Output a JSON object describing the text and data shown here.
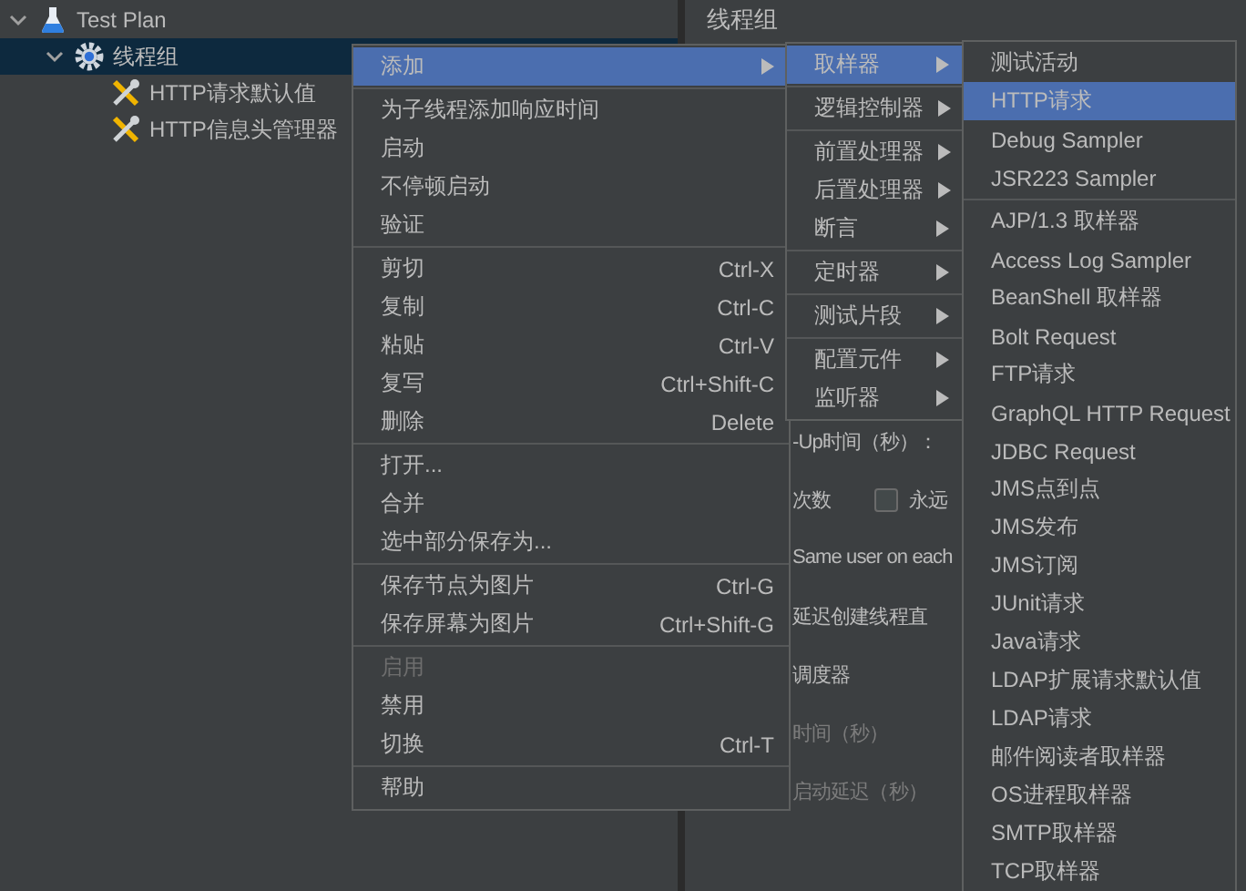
{
  "tree": [
    {
      "label": "Test Plan",
      "kind": "flask",
      "expanded": true,
      "selected": false,
      "children": [
        {
          "label": "线程组",
          "kind": "gear",
          "expanded": true,
          "selected": true,
          "children": [
            {
              "label": "HTTP请求默认值",
              "kind": "tools",
              "selected": false
            },
            {
              "label": "HTTP信息头管理器",
              "kind": "tools",
              "selected": false
            }
          ]
        }
      ]
    }
  ],
  "panel": {
    "title": "线程组",
    "fields": [
      {
        "kind": "label",
        "text": "-Up时间（秒）："
      },
      {
        "kind": "checkbox",
        "text": "次数",
        "option": "永远",
        "checked": false
      },
      {
        "kind": "label",
        "text": "Same user on each"
      },
      {
        "kind": "label",
        "text": "延迟创建线程直"
      },
      {
        "kind": "label",
        "text": "调度器"
      },
      {
        "kind": "disabled",
        "text": "时间（秒）"
      },
      {
        "kind": "disabled",
        "text": "启动延迟（秒）"
      }
    ]
  },
  "context_menu": [
    [
      {
        "label": "添加",
        "submenu": true,
        "selected": true,
        "disabled": false
      }
    ],
    [
      {
        "label": "为子线程添加响应时间",
        "selected": false,
        "disabled": false
      },
      {
        "label": "启动",
        "selected": false,
        "disabled": false
      },
      {
        "label": "不停顿启动",
        "selected": false,
        "disabled": false
      },
      {
        "label": "验证",
        "selected": false,
        "disabled": false
      }
    ],
    [
      {
        "label": "剪切",
        "shortcut": "Ctrl-X",
        "selected": false,
        "disabled": false
      },
      {
        "label": "复制",
        "shortcut": "Ctrl-C",
        "selected": false,
        "disabled": false
      },
      {
        "label": "粘贴",
        "shortcut": "Ctrl-V",
        "selected": false,
        "disabled": false
      },
      {
        "label": "复写",
        "shortcut": "Ctrl+Shift-C",
        "selected": false,
        "disabled": false
      },
      {
        "label": "删除",
        "shortcut": "Delete",
        "selected": false,
        "disabled": false
      }
    ],
    [
      {
        "label": "打开...",
        "selected": false,
        "disabled": false
      },
      {
        "label": "合并",
        "selected": false,
        "disabled": false
      },
      {
        "label": "选中部分保存为...",
        "selected": false,
        "disabled": false
      }
    ],
    [
      {
        "label": "保存节点为图片",
        "shortcut": "Ctrl-G",
        "selected": false,
        "disabled": false
      },
      {
        "label": "保存屏幕为图片",
        "shortcut": "Ctrl+Shift-G",
        "selected": false,
        "disabled": false
      }
    ],
    [
      {
        "label": "启用",
        "selected": false,
        "disabled": true
      },
      {
        "label": "禁用",
        "selected": false,
        "disabled": false
      },
      {
        "label": "切换",
        "shortcut": "Ctrl-T",
        "selected": false,
        "disabled": false
      }
    ],
    [
      {
        "label": "帮助",
        "selected": false,
        "disabled": false
      }
    ]
  ],
  "add_menu": [
    [
      {
        "label": "取样器",
        "submenu": true,
        "selected": true
      }
    ],
    [
      {
        "label": "逻辑控制器",
        "submenu": true,
        "selected": false
      }
    ],
    [
      {
        "label": "前置处理器",
        "submenu": true,
        "selected": false
      },
      {
        "label": "后置处理器",
        "submenu": true,
        "selected": false
      },
      {
        "label": "断言",
        "submenu": true,
        "selected": false
      }
    ],
    [
      {
        "label": "定时器",
        "submenu": true,
        "selected": false
      }
    ],
    [
      {
        "label": "测试片段",
        "submenu": true,
        "selected": false
      }
    ],
    [
      {
        "label": "配置元件",
        "submenu": true,
        "selected": false
      },
      {
        "label": "监听器",
        "submenu": true,
        "selected": false
      }
    ]
  ],
  "sampler_menu": [
    [
      {
        "label": "测试活动",
        "selected": false
      },
      {
        "label": "HTTP请求",
        "selected": true
      },
      {
        "label": "Debug Sampler",
        "selected": false
      },
      {
        "label": "JSR223 Sampler",
        "selected": false
      }
    ],
    [
      {
        "label": "AJP/1.3 取样器",
        "selected": false
      },
      {
        "label": "Access Log Sampler",
        "selected": false
      },
      {
        "label": "BeanShell 取样器",
        "selected": false
      },
      {
        "label": "Bolt Request",
        "selected": false
      },
      {
        "label": "FTP请求",
        "selected": false
      },
      {
        "label": "GraphQL HTTP Request",
        "selected": false
      },
      {
        "label": "JDBC Request",
        "selected": false
      },
      {
        "label": "JMS点到点",
        "selected": false
      },
      {
        "label": "JMS发布",
        "selected": false
      },
      {
        "label": "JMS订阅",
        "selected": false
      },
      {
        "label": "JUnit请求",
        "selected": false
      },
      {
        "label": "Java请求",
        "selected": false
      },
      {
        "label": "LDAP扩展请求默认值",
        "selected": false
      },
      {
        "label": "LDAP请求",
        "selected": false
      },
      {
        "label": "邮件阅读者取样器",
        "selected": false
      },
      {
        "label": "OS进程取样器",
        "selected": false
      },
      {
        "label": "SMTP取样器",
        "selected": false
      },
      {
        "label": "TCP取样器",
        "selected": false
      }
    ]
  ]
}
